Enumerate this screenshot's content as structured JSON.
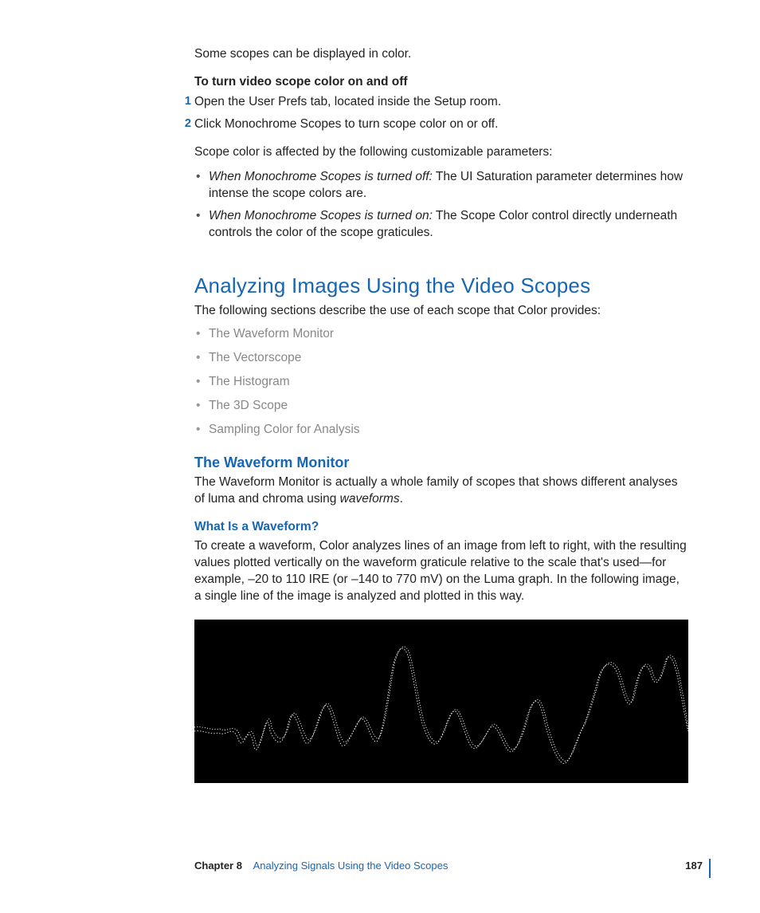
{
  "intro_para": "Some scopes can be displayed in color.",
  "task_heading": "To turn video scope color on and off",
  "steps": [
    {
      "num": "1",
      "text": "Open the User Prefs tab, located inside the Setup room."
    },
    {
      "num": "2",
      "text": "Click Monochrome Scopes to turn scope color on or off."
    }
  ],
  "affected_para": "Scope color is affected by the following customizable parameters:",
  "param_bullets": [
    {
      "lead": "When Monochrome Scopes is turned off:",
      "rest": "  The UI Saturation parameter determines how intense the scope colors are."
    },
    {
      "lead": "When Monochrome Scopes is turned on:",
      "rest": "  The Scope Color control directly underneath controls the color of the scope graticules."
    }
  ],
  "section_title": "Analyzing Images Using the Video Scopes",
  "section_intro": "The following sections describe the use of each scope that Color provides:",
  "toc_items": [
    "The Waveform Monitor",
    "The Vectorscope",
    "The Histogram",
    "The 3D Scope",
    "Sampling Color for Analysis"
  ],
  "sub_title": "The Waveform Monitor",
  "sub_para_a": "The Waveform Monitor is actually a whole family of scopes that shows different analyses of luma and chroma using ",
  "sub_para_ital": "waveforms",
  "sub_para_b": ".",
  "subsub_title": "What Is a Waveform?",
  "subsub_para": "To create a waveform, Color analyzes lines of an image from left to right, with the resulting values plotted vertically on the waveform graticule relative to the scale that's used—for example, –20 to 110 IRE (or –140 to 770 mV) on the Luma graph. In the following image, a single line of the image is analyzed and plotted in this way.",
  "footer": {
    "chapter_label": "Chapter 8",
    "chapter_title": "Analyzing Signals Using the Video Scopes",
    "page_number": "187"
  }
}
